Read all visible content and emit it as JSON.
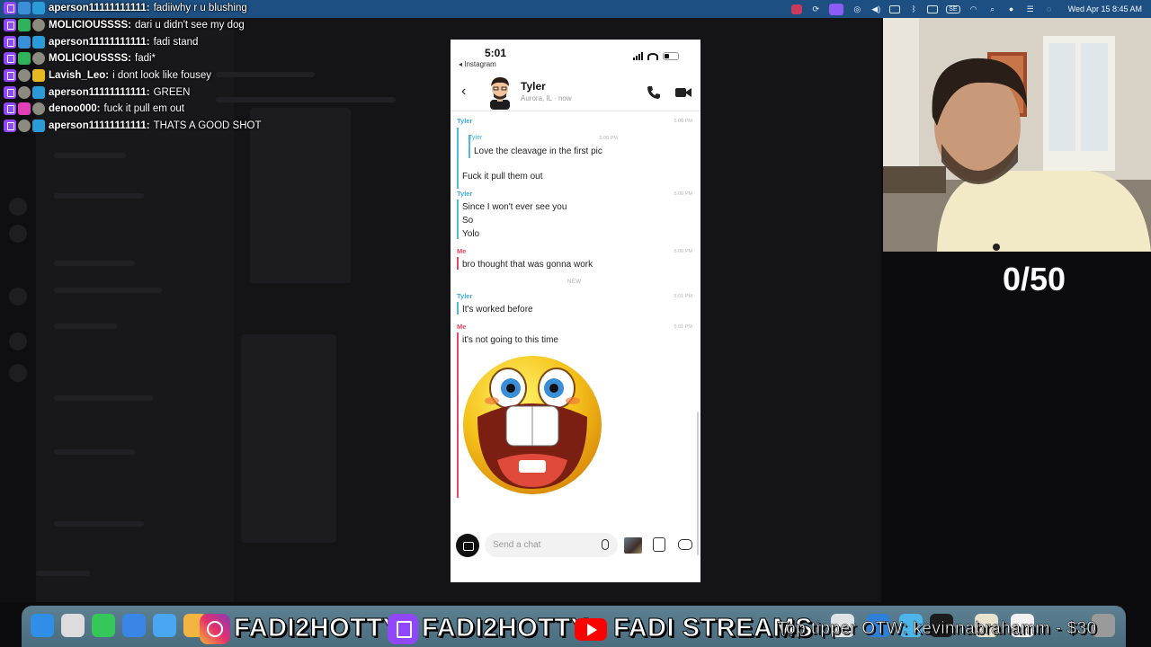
{
  "menubar": {
    "datetime": "Wed Apr 15  8:45 AM",
    "input_source": "SE",
    "icons": [
      "tailscale-icon",
      "sync-icon",
      "screen-record-icon",
      "airplay-icon",
      "volume-icon",
      "display-icon",
      "bluetooth-icon",
      "window-icon",
      "input-source-icon",
      "wifi-icon",
      "spotlight-icon",
      "siri-icon",
      "control-center-icon",
      "notification-icon"
    ]
  },
  "chat_overlay": {
    "messages": [
      {
        "badges": [
          "twitch",
          "gift",
          "crown"
        ],
        "user": "aperson11111111111:",
        "text": "fadiiwhy r u blushing"
      },
      {
        "badges": [
          "twitch",
          "check",
          "bag"
        ],
        "user": "MOLICIOUSSSS:",
        "text": "dari u didn't see my dog"
      },
      {
        "badges": [
          "twitch",
          "gift",
          "crown"
        ],
        "user": "aperson11111111111:",
        "text": "fadi stand"
      },
      {
        "badges": [
          "twitch",
          "check",
          "bag"
        ],
        "user": "MOLICIOUSSSS:",
        "text": "fadi*"
      },
      {
        "badges": [
          "twitch",
          "bag",
          "gold"
        ],
        "user": "Lavish_Leo:",
        "text": "i dont look like fousey"
      },
      {
        "badges": [
          "twitch",
          "bag",
          "crown"
        ],
        "user": "aperson11111111111:",
        "text": "GREEN"
      },
      {
        "badges": [
          "twitch",
          "heart",
          "bag"
        ],
        "user": "denoo000:",
        "text": "fuck it pull em out"
      },
      {
        "badges": [
          "twitch",
          "bag",
          "crown"
        ],
        "user": "aperson11111111111:",
        "text": "THATS A GOOD SHOT"
      }
    ]
  },
  "phone": {
    "status_time": "5:01",
    "back_app": "◂ Instagram",
    "header": {
      "name": "Tyler",
      "subtitle": "Aurora, IL · now"
    },
    "messages": [
      {
        "sender": "Tyler",
        "time": "5:00 PM"
      },
      {
        "quote_sender": "Tyler",
        "quote_time": "5:00 PM",
        "quote_text": "Love the cleavage in the first pic"
      },
      {
        "text": "Fuck it pull them out"
      },
      {
        "sender": "Tyler",
        "time": "5:00 PM",
        "lines": [
          "Since I won't ever see you",
          "So",
          "Yolo"
        ]
      },
      {
        "sender": "Me",
        "time": "5:00 PM",
        "text": "bro thought that was gonna work"
      },
      {
        "divider": "NEW"
      },
      {
        "sender": "Tyler",
        "time": "5:01 PM",
        "text": "It's worked before"
      },
      {
        "sender": "Me",
        "time": "5:01 PM",
        "text": "it's not going to this time"
      }
    ],
    "composer": {
      "placeholder": "Send a chat"
    }
  },
  "stream": {
    "goal": "0/50",
    "ticker_handle": "FADI2HOTTY",
    "ticker_tail": "FADI STREAMS",
    "top_tipper": "Top tipper OTW: kevinnabrahamm - $30"
  },
  "colors": {
    "menubar": "#1d4f82",
    "them": "#3fa9d9",
    "me": "#e0455d",
    "twitch": "#9146ff"
  }
}
